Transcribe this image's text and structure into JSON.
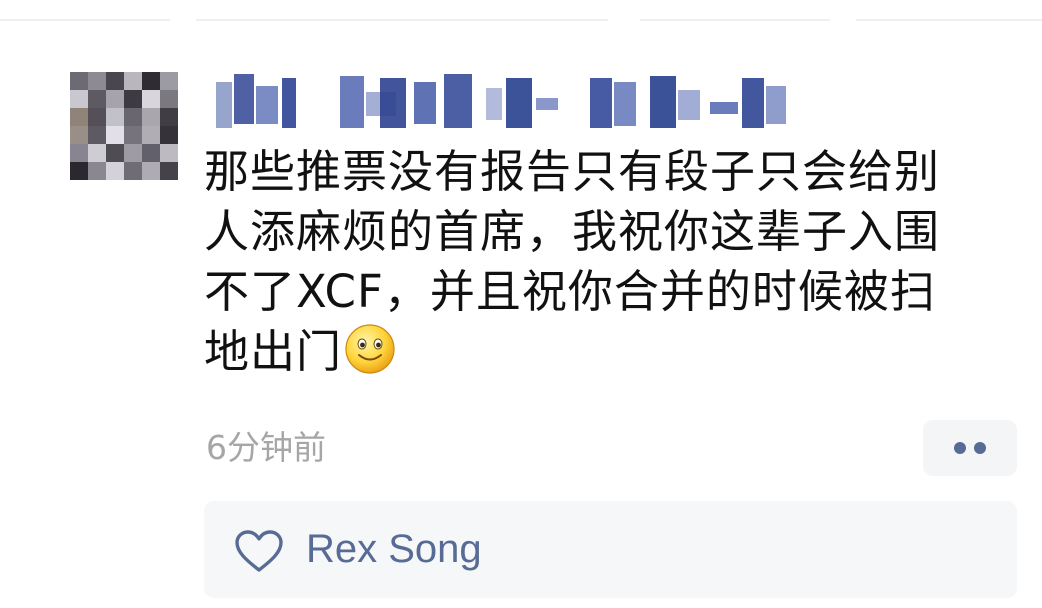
{
  "comment": {
    "line1": "那些推票没有报告只有段子只会给别",
    "line2": "人添麻烦的首席，我祝你这辈子入围",
    "line3": "不了XCF，并且祝你合并的时候被扫",
    "line4": "地出门",
    "emoji": "smiley-emoji"
  },
  "timestamp": "6分钟前",
  "likes": {
    "icon": "heart-outline-icon",
    "names": "Rex Song"
  },
  "colors": {
    "link_blue": "#576b95",
    "timestamp_gray": "#a6a6a6",
    "panel_bg": "#f6f7f9"
  }
}
